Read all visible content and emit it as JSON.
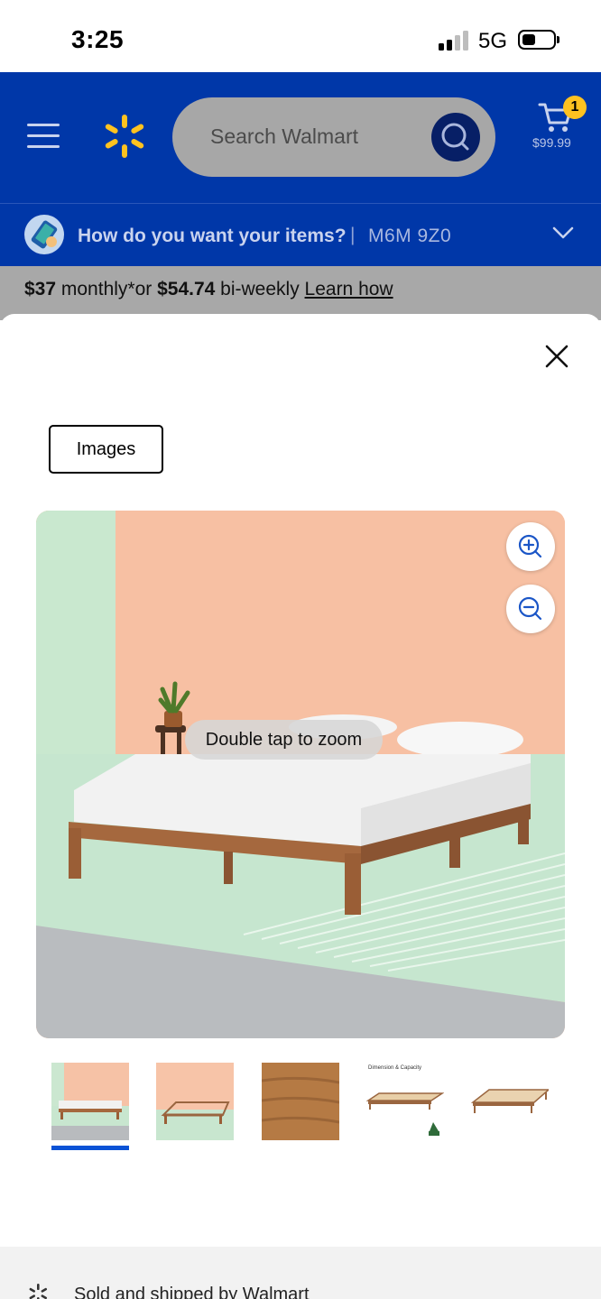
{
  "status_bar": {
    "time": "3:25",
    "network": "5G"
  },
  "header": {
    "search_placeholder": "Search Walmart",
    "cart_count": "1",
    "cart_total": "$99.99",
    "brand_color": "#0037a8",
    "spark_color": "#ffc220"
  },
  "delivery": {
    "question": "How do you want your items?",
    "separator": "|",
    "postal_code": "M6M 9Z0"
  },
  "financing": {
    "monthly_amount": "$37",
    "monthly_text": " monthly*or ",
    "biweekly_amount": "$54.74",
    "biweekly_text": " bi-weekly ",
    "link": "Learn how"
  },
  "modal": {
    "tab_label": "Images",
    "zoom_hint": "Double tap to zoom",
    "thumbnails": [
      {
        "label": "bed-room-photo",
        "selected": true
      },
      {
        "label": "frame-photo",
        "selected": false
      },
      {
        "label": "wood-texture",
        "selected": false
      },
      {
        "label": "dimension-and-capacity",
        "selected": false,
        "caption": "Dimension & Capacity"
      },
      {
        "label": "frame-angle",
        "selected": false
      }
    ],
    "selected_color": "#0a52d6"
  },
  "seller": {
    "text": "Sold and shipped by Walmart"
  }
}
